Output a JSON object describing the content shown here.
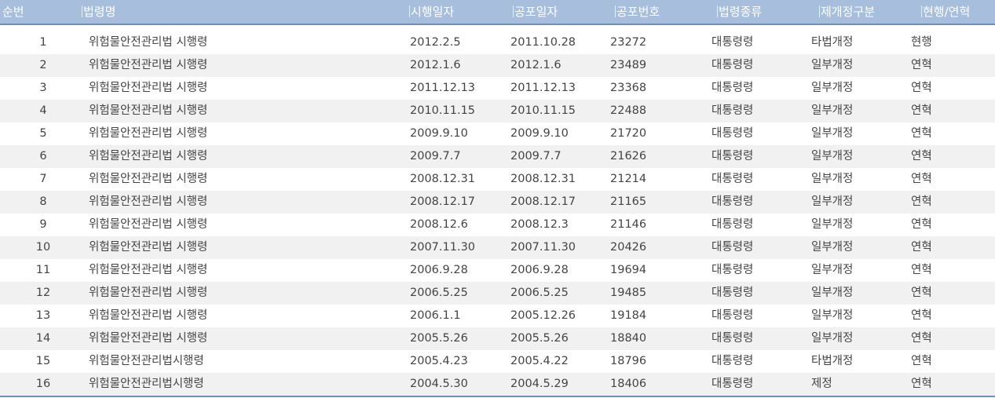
{
  "headers": {
    "no": "순번",
    "name": "법령명",
    "effective_date": "시행일자",
    "promulgation_date": "공포일자",
    "promulgation_no": "공포번호",
    "law_kind": "법령종류",
    "revision_type": "제개정구분",
    "status": "현행/연혁"
  },
  "rows": [
    {
      "no": "1",
      "name": "위험물안전관리법 시행령",
      "effective_date": "2012.2.5",
      "promulgation_date": "2011.10.28",
      "promulgation_no": "23272",
      "law_kind": "대통령령",
      "revision_type": "타법개정",
      "status": "현행"
    },
    {
      "no": "2",
      "name": "위험물안전관리법 시행령",
      "effective_date": "2012.1.6",
      "promulgation_date": "2012.1.6",
      "promulgation_no": "23489",
      "law_kind": "대통령령",
      "revision_type": "일부개정",
      "status": "연혁"
    },
    {
      "no": "3",
      "name": "위험물안전관리법 시행령",
      "effective_date": "2011.12.13",
      "promulgation_date": "2011.12.13",
      "promulgation_no": "23368",
      "law_kind": "대통령령",
      "revision_type": "일부개정",
      "status": "연혁"
    },
    {
      "no": "4",
      "name": "위험물안전관리법 시행령",
      "effective_date": "2010.11.15",
      "promulgation_date": "2010.11.15",
      "promulgation_no": "22488",
      "law_kind": "대통령령",
      "revision_type": "일부개정",
      "status": "연혁"
    },
    {
      "no": "5",
      "name": "위험물안전관리법 시행령",
      "effective_date": "2009.9.10",
      "promulgation_date": "2009.9.10",
      "promulgation_no": "21720",
      "law_kind": "대통령령",
      "revision_type": "일부개정",
      "status": "연혁"
    },
    {
      "no": "6",
      "name": "위험물안전관리법 시행령",
      "effective_date": "2009.7.7",
      "promulgation_date": "2009.7.7",
      "promulgation_no": "21626",
      "law_kind": "대통령령",
      "revision_type": "일부개정",
      "status": "연혁"
    },
    {
      "no": "7",
      "name": "위험물안전관리법 시행령",
      "effective_date": "2008.12.31",
      "promulgation_date": "2008.12.31",
      "promulgation_no": "21214",
      "law_kind": "대통령령",
      "revision_type": "일부개정",
      "status": "연혁"
    },
    {
      "no": "8",
      "name": "위험물안전관리법 시행령",
      "effective_date": "2008.12.17",
      "promulgation_date": "2008.12.17",
      "promulgation_no": "21165",
      "law_kind": "대통령령",
      "revision_type": "일부개정",
      "status": "연혁"
    },
    {
      "no": "9",
      "name": "위험물안전관리법 시행령",
      "effective_date": "2008.12.6",
      "promulgation_date": "2008.12.3",
      "promulgation_no": "21146",
      "law_kind": "대통령령",
      "revision_type": "일부개정",
      "status": "연혁"
    },
    {
      "no": "10",
      "name": "위험물안전관리법 시행령",
      "effective_date": "2007.11.30",
      "promulgation_date": "2007.11.30",
      "promulgation_no": "20426",
      "law_kind": "대통령령",
      "revision_type": "일부개정",
      "status": "연혁"
    },
    {
      "no": "11",
      "name": "위험물안전관리법 시행령",
      "effective_date": "2006.9.28",
      "promulgation_date": "2006.9.28",
      "promulgation_no": "19694",
      "law_kind": "대통령령",
      "revision_type": "일부개정",
      "status": "연혁"
    },
    {
      "no": "12",
      "name": "위험물안전관리법 시행령",
      "effective_date": "2006.5.25",
      "promulgation_date": "2006.5.25",
      "promulgation_no": "19485",
      "law_kind": "대통령령",
      "revision_type": "일부개정",
      "status": "연혁"
    },
    {
      "no": "13",
      "name": "위험물안전관리법 시행령",
      "effective_date": "2006.1.1",
      "promulgation_date": "2005.12.26",
      "promulgation_no": "19184",
      "law_kind": "대통령령",
      "revision_type": "일부개정",
      "status": "연혁"
    },
    {
      "no": "14",
      "name": "위험물안전관리법 시행령",
      "effective_date": "2005.5.26",
      "promulgation_date": "2005.5.26",
      "promulgation_no": "18840",
      "law_kind": "대통령령",
      "revision_type": "일부개정",
      "status": "연혁"
    },
    {
      "no": "15",
      "name": "위험물안전관리법시행령",
      "effective_date": "2005.4.23",
      "promulgation_date": "2005.4.22",
      "promulgation_no": "18796",
      "law_kind": "대통령령",
      "revision_type": "타법개정",
      "status": "연혁"
    },
    {
      "no": "16",
      "name": "위험물안전관리법시행령",
      "effective_date": "2004.5.30",
      "promulgation_date": "2004.5.29",
      "promulgation_no": "18406",
      "law_kind": "대통령령",
      "revision_type": "제정",
      "status": "연혁"
    }
  ],
  "colors": {
    "header_bg": "#a7bfdc",
    "header_border": "#6f8fb8",
    "alt_row_bg": "#f1f1f1"
  }
}
